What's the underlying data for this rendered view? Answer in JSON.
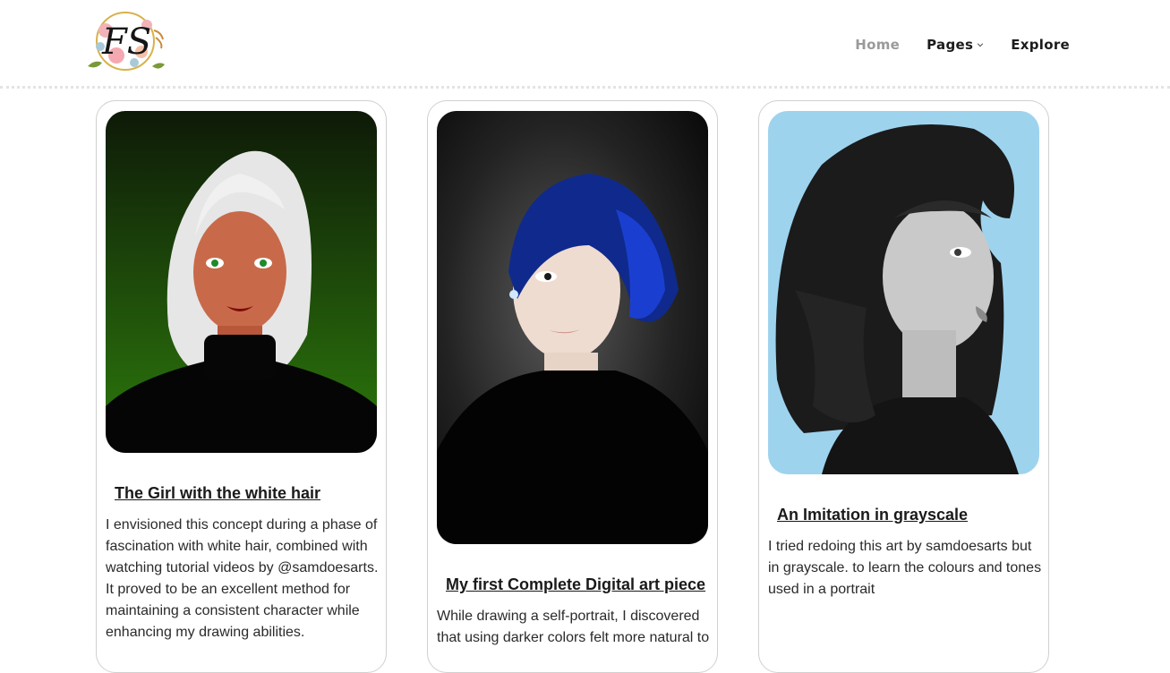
{
  "brand": {
    "logo_text": "FS",
    "logo_icon": "floral-wreath-logo"
  },
  "nav": {
    "items": [
      {
        "label": "Home",
        "active": true
      },
      {
        "label": "Pages",
        "has_dropdown": true
      },
      {
        "label": "Explore"
      }
    ]
  },
  "cards": [
    {
      "title": "The Girl with the white hair",
      "description": "I envisioned this concept during a phase of fascination with white hair, combined with watching tutorial videos by @samdoesarts. It proved to be an excellent method for maintaining a consistent character while enhancing my drawing abilities.",
      "image": "portrait-white-hair-green-background"
    },
    {
      "title": "My first Complete Digital art piece",
      "description": "While drawing a self-portrait, I discovered that using darker colors felt more natural to",
      "image": "portrait-blue-hair-dark-background"
    },
    {
      "title": "An Imitation in grayscale",
      "description": "I tried redoing this art by samdoesarts but in grayscale. to learn the colours and tones used in a portrait",
      "image": "portrait-grayscale-curly-hair-blue-background"
    }
  ],
  "colors": {
    "nav_active": "#9a9a9a",
    "nav_text": "#1c1c1c",
    "card_border": "#d0d0d0",
    "art1_bg": "#1f5a0c",
    "art2_bg": "#1c1c1c",
    "art3_bg": "#9ed3ee"
  }
}
